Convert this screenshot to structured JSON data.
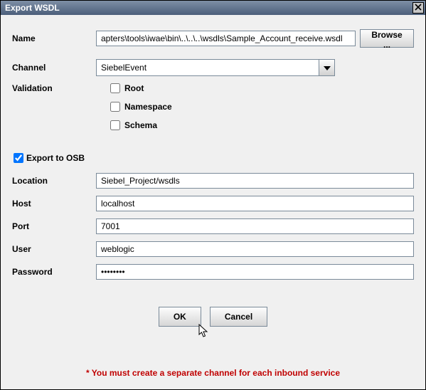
{
  "dialog": {
    "title": "Export WSDL"
  },
  "form": {
    "name_label": "Name",
    "name_value": "apters\\tools\\iwae\\bin\\..\\..\\..\\wsdls\\Sample_Account_receive.wsdl",
    "browse_label": "Browse ...",
    "channel_label": "Channel",
    "channel_value": "SiebelEvent",
    "validation_label": "Validation",
    "root_label": "Root",
    "namespace_label": "Namespace",
    "schema_label": "Schema",
    "export_osb_label": "Export to OSB",
    "location_label": "Location",
    "location_value": "Siebel_Project/wsdls",
    "host_label": "Host",
    "host_value": "localhost",
    "port_label": "Port",
    "port_value": "7001",
    "user_label": "User",
    "user_value": "weblogic",
    "password_label": "Password",
    "password_value": "••••••••"
  },
  "buttons": {
    "ok": "OK",
    "cancel": "Cancel"
  },
  "footnote": "* You must create a separate channel for each inbound service"
}
